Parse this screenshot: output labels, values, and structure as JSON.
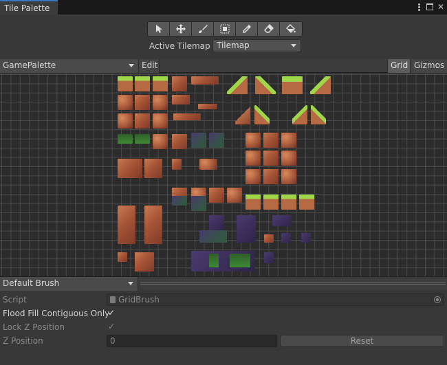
{
  "window": {
    "title": "Tile Palette"
  },
  "toolbar": {
    "tools": [
      {
        "name": "select-tool",
        "icon": "arrow-cursor-icon"
      },
      {
        "name": "move-tool",
        "icon": "move-arrows-icon"
      },
      {
        "name": "paint-tool",
        "icon": "paintbrush-icon"
      },
      {
        "name": "box-fill-tool",
        "icon": "box-fill-icon"
      },
      {
        "name": "picker-tool",
        "icon": "eyedropper-icon"
      },
      {
        "name": "erase-tool",
        "icon": "eraser-icon"
      },
      {
        "name": "fill-tool",
        "icon": "paint-bucket-icon"
      }
    ]
  },
  "active_tilemap": {
    "label": "Active Tilemap",
    "value": "Tilemap"
  },
  "palette_bar": {
    "palette": "GamePalette",
    "edit": "Edit",
    "grid": "Grid",
    "gizmos": "Gizmos"
  },
  "brush": {
    "selected": "Default Brush",
    "script_label": "Script",
    "script_value": "GridBrush",
    "flood_label": "Flood Fill Contiguous Only",
    "flood_checked": "✓",
    "lockz_label": "Lock Z Position",
    "lockz_checked": "✓",
    "zpos_label": "Z Position",
    "zpos_value": "0",
    "reset": "Reset"
  },
  "colors": {
    "tab_accent": "#3a79bb",
    "grass": "#9fd64a",
    "earth": "#b56a44",
    "purple": "#4a3b6e"
  }
}
